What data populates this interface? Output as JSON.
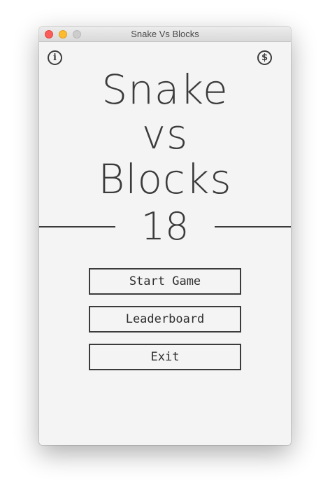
{
  "window": {
    "title": "Snake Vs Blocks",
    "controls": {
      "close_color": "#fc5c57",
      "minimize_color": "#fdbc2e",
      "zoom_color": "#cdcdcd"
    }
  },
  "toolbar": {
    "info_icon": {
      "icon": "info-icon",
      "glyph": "i"
    },
    "dollar_icon": {
      "icon": "dollar-icon",
      "glyph": "$"
    }
  },
  "title_lines": [
    "Snake",
    "vs",
    "Blocks"
  ],
  "score": "18",
  "menu": {
    "start_label": "Start Game",
    "leaderboard_label": "Leaderboard",
    "exit_label": "Exit"
  }
}
